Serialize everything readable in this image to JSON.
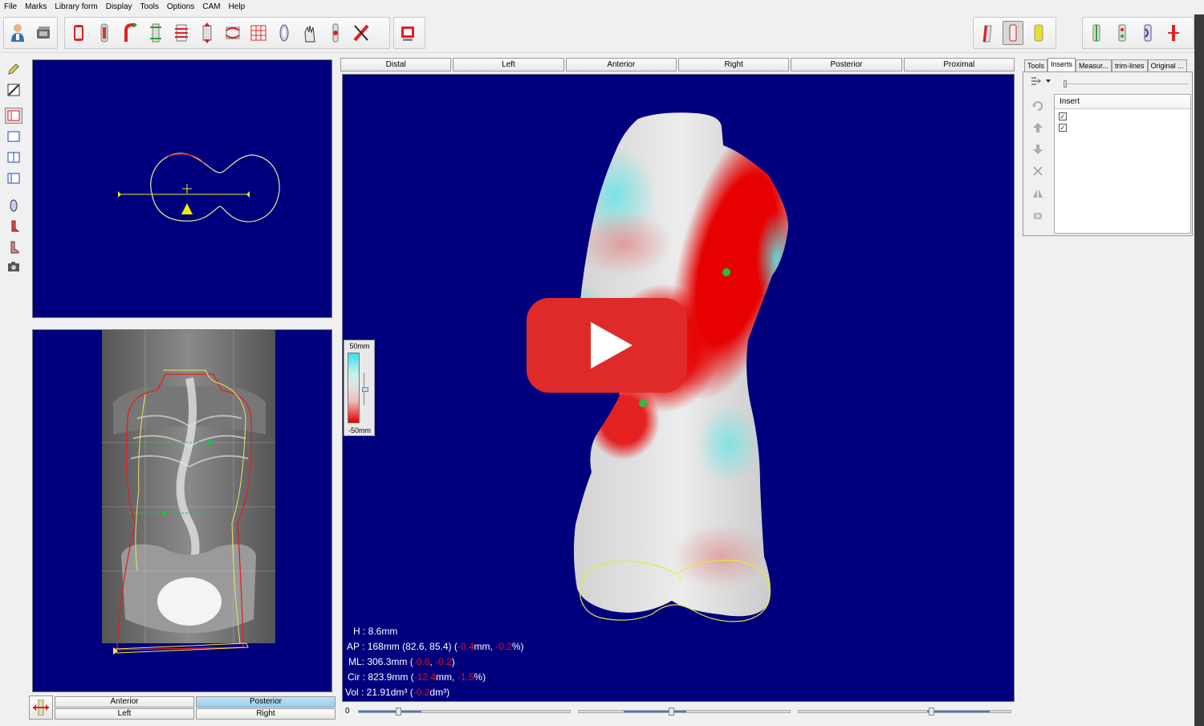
{
  "menu": [
    "File",
    "Marks",
    "Library form",
    "Display",
    "Tools",
    "Options",
    "CAM",
    "Help"
  ],
  "toolbar_groups": {
    "g1": [
      "patient-icon",
      "scanner-icon"
    ],
    "g2": [
      "cylinder-red-icon",
      "cylinder-tall-icon",
      "bend-icon",
      "column-icon",
      "ribs-icon",
      "stretch-icon",
      "blend-icon",
      "grid-icon",
      "lens-icon",
      "hand-icon",
      "mark-icon",
      "measure-icon"
    ],
    "g3": [
      "export-icon"
    ],
    "right1": [
      "front-view-icon",
      "side-view-icon",
      "solid-view-icon"
    ],
    "right2": [
      "marks-icon-1",
      "marks-icon-2",
      "marks-icon-3",
      "marks-icon-4"
    ]
  },
  "view_tabs": [
    "Distal",
    "Left",
    "Anterior",
    "Right",
    "Posterior",
    "Proximal"
  ],
  "scale": {
    "top": "50mm",
    "bottom": "-50mm"
  },
  "measurements": {
    "h": "H : 8.6mm",
    "ap_main": "AP : 168mm (82.6, 85.4) (",
    "ap_d1": "-0.4",
    "ap_mid": "mm, ",
    "ap_d2": "-0.2",
    "ap_end": "%)",
    "ml_main": "ML: 306.3mm (",
    "ml_d1": "-0.8",
    "ml_mid": ", ",
    "ml_d2": "-0.2",
    "ml_end": ")",
    "cir_main": "Cir : 823.9mm (",
    "cir_d1": "-12.4",
    "cir_mid": "mm, ",
    "cir_d2": "-1.5",
    "cir_end": "%)",
    "vol_main": "Vol : 21.91dm³ (",
    "vol_d1": "-0.2",
    "vol_end": "dm³)"
  },
  "bottom": {
    "zero": "0"
  },
  "lower_buttons": {
    "anterior": "Anterior",
    "posterior": "Posterior",
    "left": "Left",
    "right": "Right"
  },
  "right_tabs": [
    "Tools",
    "Inserts",
    "Measur...",
    "trim-lines",
    "Original ..."
  ],
  "insert": {
    "header": "Insert",
    "check": "✓"
  },
  "colors": {
    "viewport": "#00007f",
    "deviation_neg": "#e01010",
    "deviation_pos": "#37e0e6",
    "outline": "#e8e830"
  }
}
